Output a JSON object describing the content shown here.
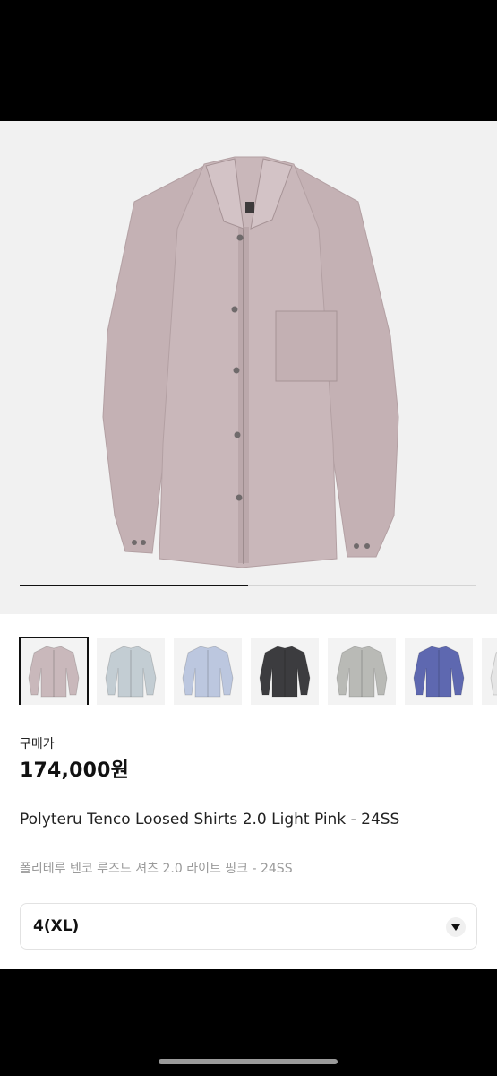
{
  "product": {
    "price_label": "구매가",
    "price": "174,000원",
    "title_en": "Polyteru Tenco Loosed Shirts 2.0 Light Pink - 24SS",
    "title_ko": "폴리테루 텐코 루즈드 셔츠 2.0 라이트 핑크 - 24SS"
  },
  "gallery": {
    "progress": 0.5,
    "thumbnails": [
      {
        "color": "Light Pink",
        "fill": "#c9b8bb",
        "selected": true
      },
      {
        "color": "Light Gray Blue",
        "fill": "#c3cdd3",
        "selected": false
      },
      {
        "color": "Light Blue",
        "fill": "#bcc7df",
        "selected": false
      },
      {
        "color": "Charcoal",
        "fill": "#3c3c3f",
        "selected": false
      },
      {
        "color": "Gray",
        "fill": "#b9bab6",
        "selected": false
      },
      {
        "color": "Blue",
        "fill": "#5e68b0",
        "selected": false
      },
      {
        "color": "White",
        "fill": "#e5e5e5",
        "selected": false
      }
    ]
  },
  "option": {
    "selected_value": "4(XL)"
  },
  "colors": {
    "shirt": "#c8b6b9",
    "shirt_shadow": "#b7a3a6",
    "background": "#f1f1f1"
  }
}
